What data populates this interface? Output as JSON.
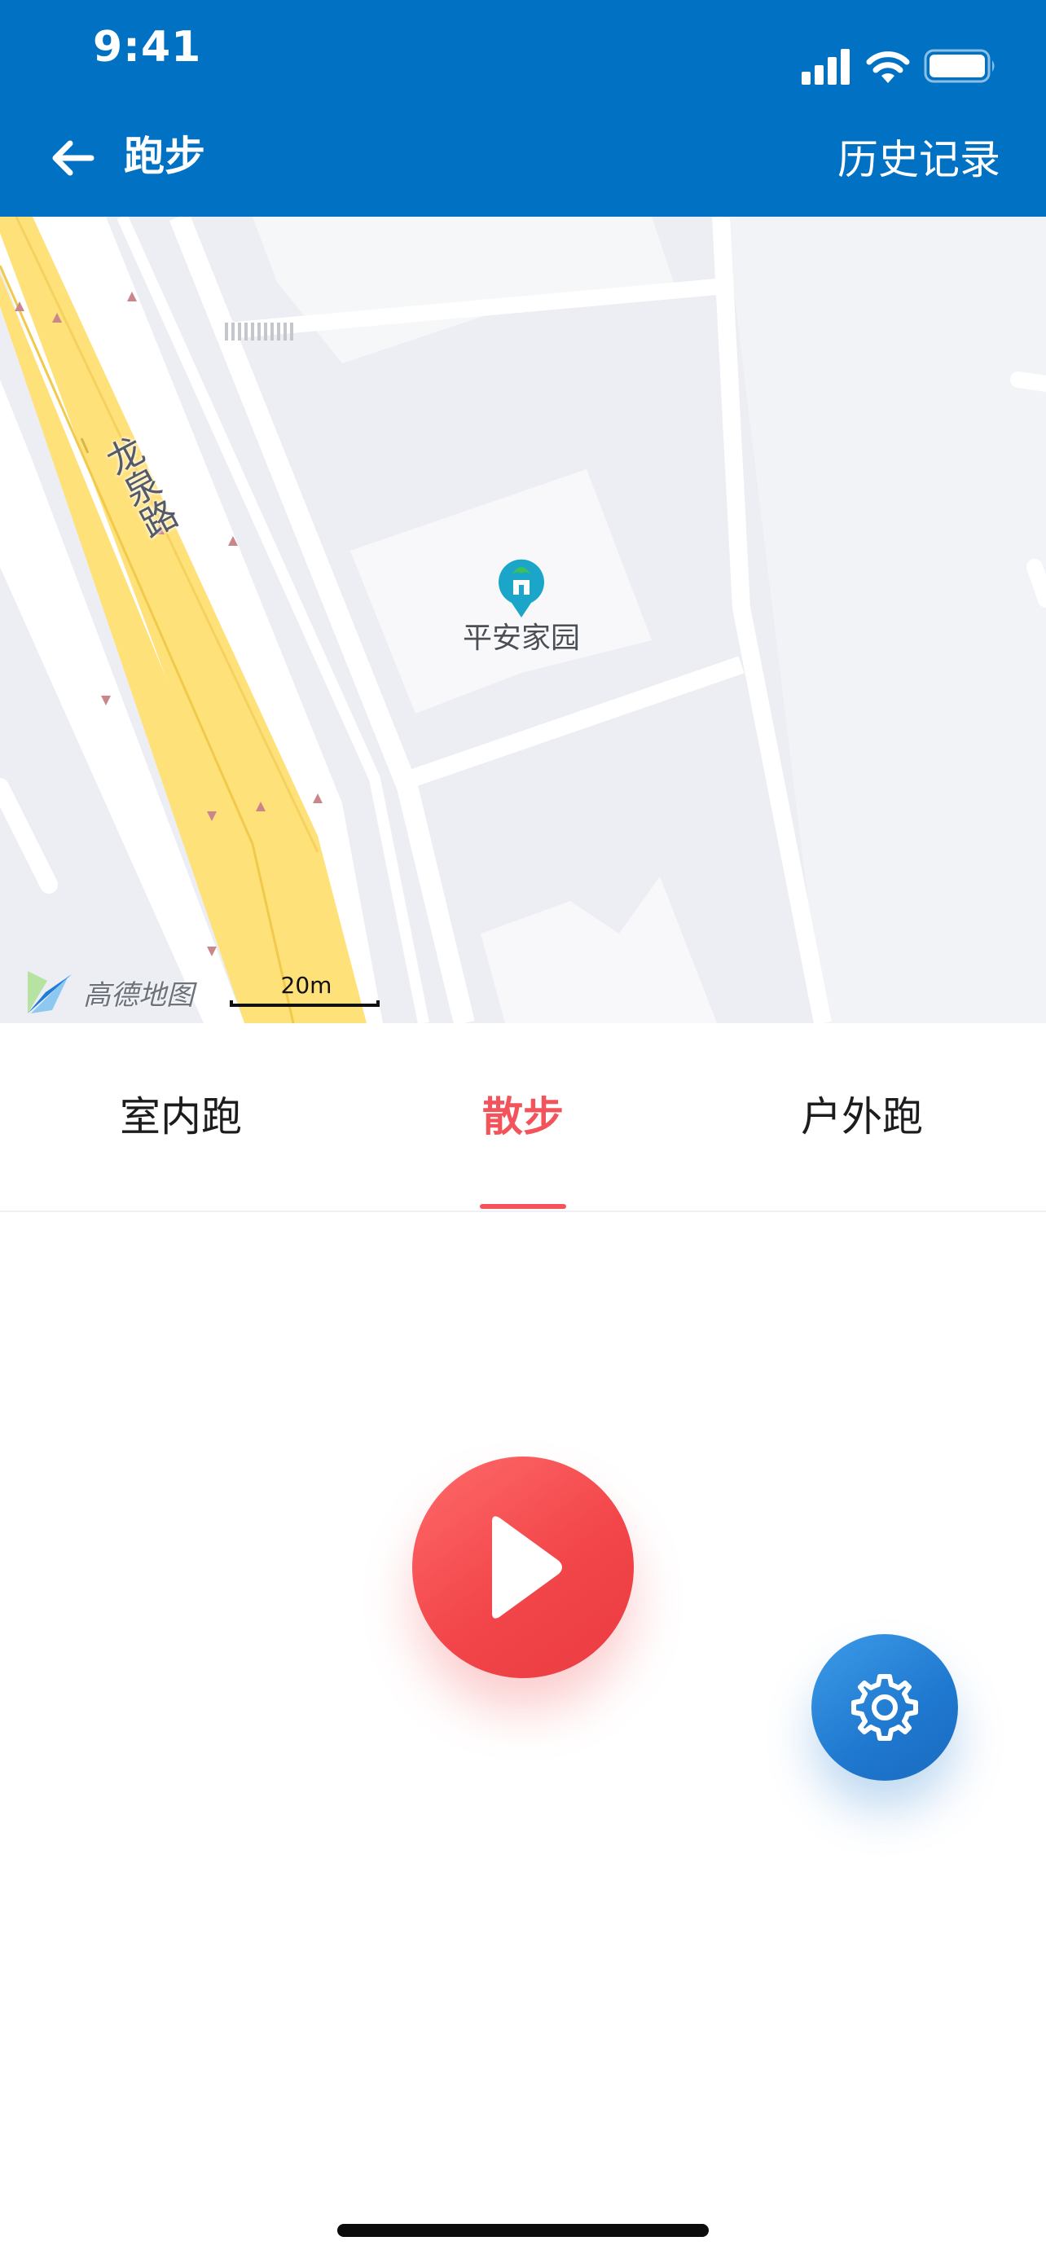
{
  "status_bar": {
    "time": "9:41",
    "icons": [
      "signal-icon",
      "wifi-icon",
      "battery-icon"
    ]
  },
  "header": {
    "title": "跑步",
    "back_icon": "arrow-left-icon",
    "history_label": "历史记录",
    "background_color": "#0171c3"
  },
  "map": {
    "road_name": "龙泉路",
    "poi_name": "平安家园",
    "provider_logo_text": "高德地图",
    "scale_label": "20m"
  },
  "tabs": [
    {
      "label": "室内跑",
      "active": false
    },
    {
      "label": "散步",
      "active": true
    },
    {
      "label": "户外跑",
      "active": false
    }
  ],
  "controls": {
    "start_icon": "play-icon",
    "settings_icon": "gear-icon",
    "accent_color": "#f3535a",
    "settings_color": "#1f78cf"
  }
}
